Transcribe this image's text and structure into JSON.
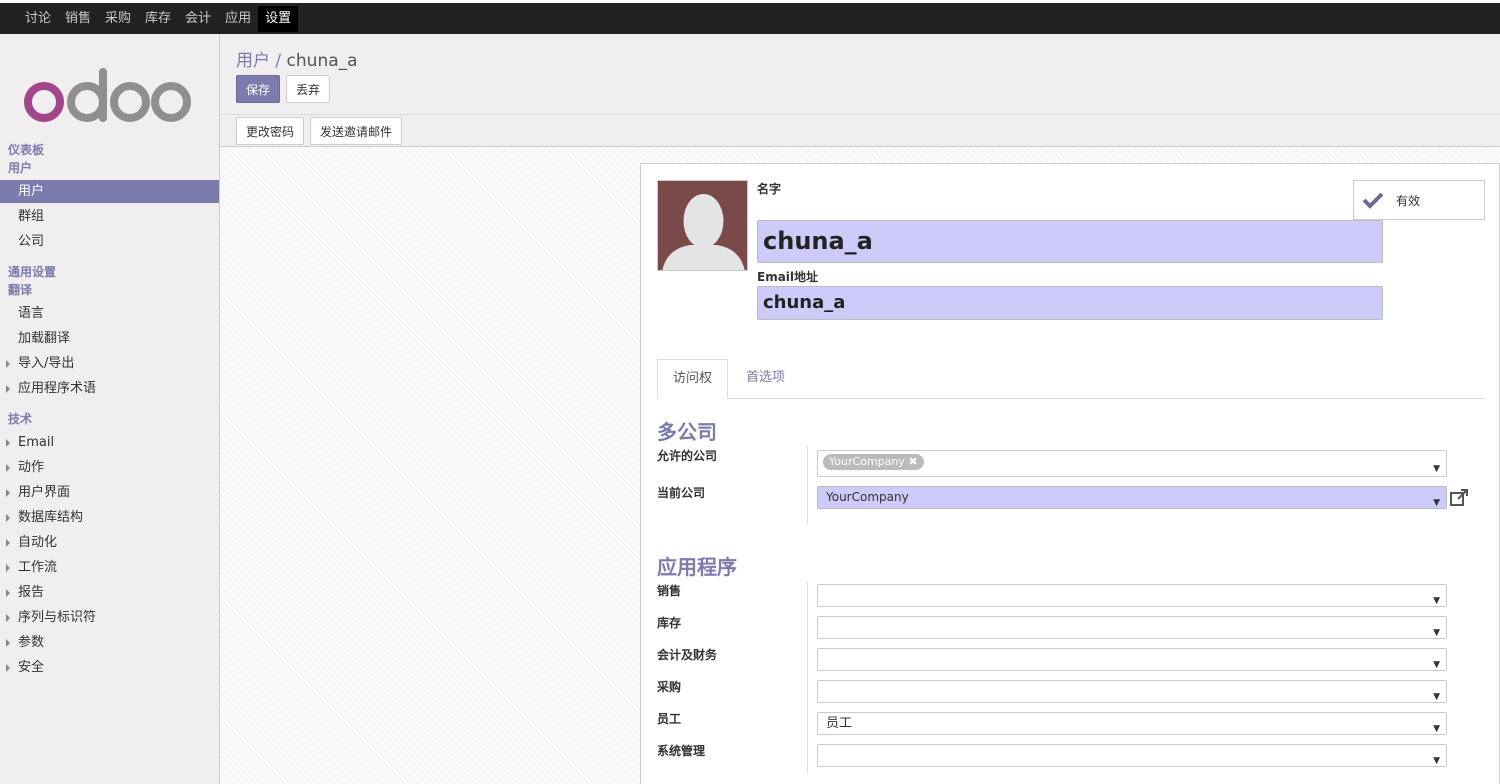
{
  "topbar": {
    "menu": [
      "讨论",
      "销售",
      "采购",
      "库存",
      "会计",
      "应用",
      "设置"
    ],
    "active_index": 6
  },
  "sidebar": {
    "logo_text": "odoo",
    "sections": {
      "dashboard": "仪表板",
      "users": "用户",
      "general": "通用设置",
      "translations": "翻译",
      "technical": "技术"
    },
    "user_items": [
      "用户",
      "群组",
      "公司"
    ],
    "translation_items": [
      "语言",
      "加载翻译",
      "导入/导出",
      "应用程序术语"
    ],
    "technical_items": [
      "Email",
      "动作",
      "用户界面",
      "数据库结构",
      "自动化",
      "工作流",
      "报告",
      "序列与标识符",
      "参数",
      "安全"
    ]
  },
  "breadcrumb": {
    "parent": "用户",
    "separator": "/",
    "current": "chuna_a"
  },
  "buttons": {
    "save": "保存",
    "discard": "丢弃",
    "change_password": "更改密码",
    "send_invite": "发送邀请邮件"
  },
  "form": {
    "name_label": "名字",
    "name_value": "chuna_a",
    "email_label": "Email地址",
    "email_value": "chuna_a",
    "active_label": "有效",
    "tabs": [
      "访问权",
      "首选项"
    ],
    "multi_company_title": "多公司",
    "allowed_companies_label": "允许的公司",
    "allowed_companies_tag": "YourCompany",
    "current_company_label": "当前公司",
    "current_company_value": "YourCompany",
    "apps_title": "应用程序",
    "apps": [
      {
        "label": "销售",
        "value": ""
      },
      {
        "label": "库存",
        "value": ""
      },
      {
        "label": "会计及财务",
        "value": ""
      },
      {
        "label": "采购",
        "value": ""
      },
      {
        "label": "员工",
        "value": "员工"
      },
      {
        "label": "系统管理",
        "value": ""
      }
    ]
  },
  "colors": {
    "brand": "#7c7bad",
    "required_field": "#cccbf9",
    "avatar_bg": "#7a4a4a"
  }
}
